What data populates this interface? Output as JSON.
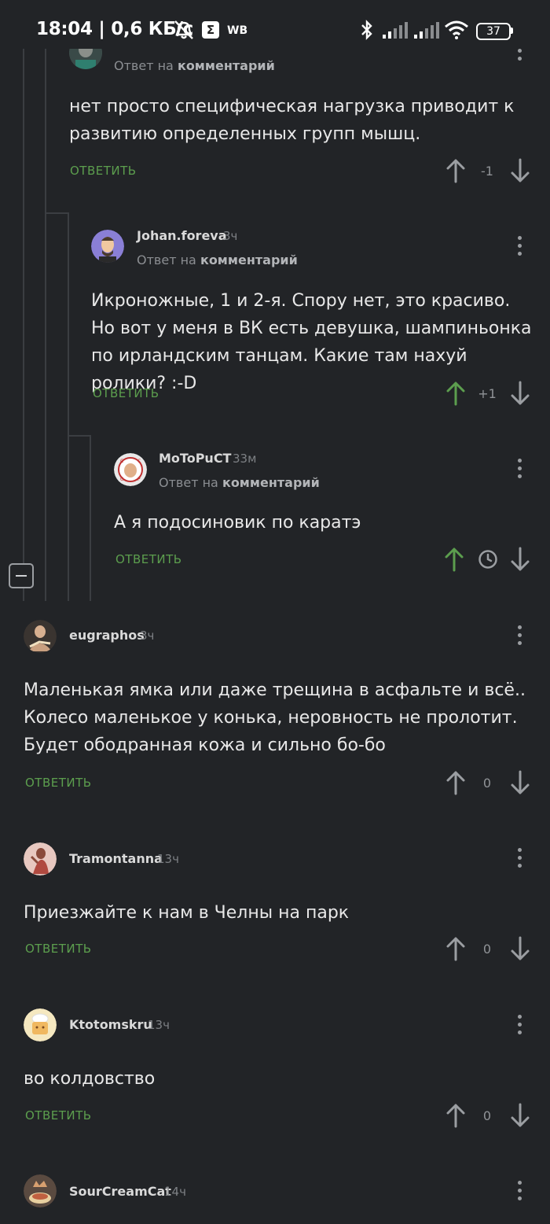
{
  "status_bar": {
    "time_speed": "18:04 | 0,6 КБ/с",
    "box_icon_glyph": "Σ",
    "wb_label": "WB",
    "battery": "37",
    "icons": [
      "alarm-off-icon",
      "bluetooth-icon",
      "signal-icon",
      "signal-icon",
      "wifi-icon",
      "battery-icon"
    ]
  },
  "reply_prefix": "Ответ на",
  "reply_target": "комментарий",
  "answer_label": "ОТВЕТИТЬ",
  "colors": {
    "background": "#222427",
    "accent_green": "#5c9e4e",
    "upvoted_arrow": "#5c9e4e",
    "neutral_arrow": "#9b9ea2"
  },
  "comments": [
    {
      "id": "c1",
      "text": "нет просто специфическая нагрузка приводит к развитию определенных групп мышц.",
      "rating": "-1",
      "upvoted": false
    },
    {
      "id": "c2",
      "username": "Johan.foreva",
      "time": "3ч",
      "text": "Икроножные, 1 и 2-я. Спору нет, это красиво. Но вот у меня в ВК есть девушка, шампиньонка по ирландским танцам. Какие там нахуй ролики? :-D",
      "rating": "+1",
      "upvoted": true
    },
    {
      "id": "c3",
      "username": "MoToPuCT",
      "time": "33м",
      "text": "А я подосиновик по каратэ",
      "rating_icon": "clock-icon",
      "upvoted": true
    },
    {
      "id": "c4",
      "username": "eugraphos",
      "time": "3ч",
      "text": "Маленькая ямка или даже трещина в асфальте и всё.. Колесо маленькое у конька, неровность не пролотит. Будет ободранная кожа и сильно бо-бо",
      "rating": "0",
      "upvoted": false
    },
    {
      "id": "c5",
      "username": "Tramontanna",
      "time": "13ч",
      "text": "Приезжайте к нам в Челны на парк",
      "rating": "0",
      "upvoted": false
    },
    {
      "id": "c6",
      "username": "Ktotomskru",
      "time": "13ч",
      "text": "во колдовство",
      "rating": "0",
      "upvoted": false
    },
    {
      "id": "c7",
      "username": "SourCreamCat",
      "time": "14ч"
    }
  ]
}
